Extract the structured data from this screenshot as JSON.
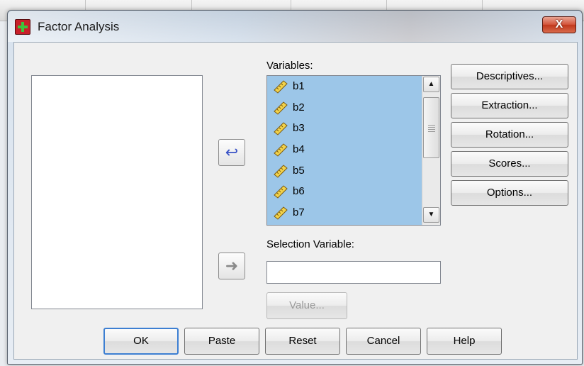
{
  "window": {
    "title": "Factor Analysis",
    "close_label": "X"
  },
  "labels": {
    "variables": "Variables:",
    "selection_variable": "Selection Variable:"
  },
  "variables": [
    {
      "name": "b1",
      "icon": "ruler-icon"
    },
    {
      "name": "b2",
      "icon": "ruler-icon"
    },
    {
      "name": "b3",
      "icon": "ruler-icon"
    },
    {
      "name": "b4",
      "icon": "ruler-icon"
    },
    {
      "name": "b5",
      "icon": "ruler-icon"
    },
    {
      "name": "b6",
      "icon": "ruler-icon"
    },
    {
      "name": "b7",
      "icon": "ruler-icon"
    }
  ],
  "selection_input": {
    "value": ""
  },
  "side_buttons": {
    "descriptives": "Descriptives...",
    "extraction": "Extraction...",
    "rotation": "Rotation...",
    "scores": "Scores...",
    "options": "Options..."
  },
  "value_button": "Value...",
  "bottom_buttons": {
    "ok": "OK",
    "paste": "Paste",
    "reset": "Reset",
    "cancel": "Cancel",
    "help": "Help"
  },
  "colors": {
    "selection_highlight": "#9cc6e8",
    "move_arrow": "#3a53c6"
  }
}
